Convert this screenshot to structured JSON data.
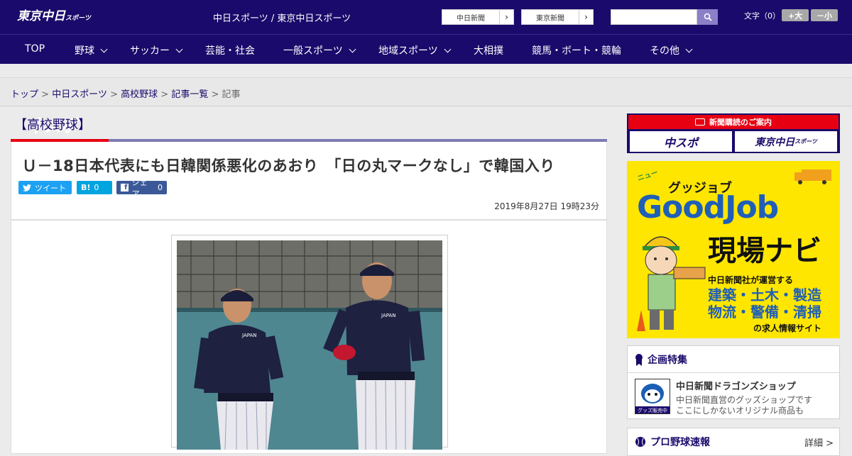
{
  "header": {
    "logo_main": "中スポ",
    "logo_sub": "東京中日",
    "logo_sub_small": "スポーツ",
    "site_name": "中日スポーツ / 東京中日スポーツ",
    "paper_chunichi": "中日新聞",
    "paper_tokyo": "東京新聞",
    "search_placeholder": "",
    "font_size_label": "文字（0）",
    "font_larger": "+大",
    "font_smaller": "－小"
  },
  "nav": {
    "items": [
      {
        "label": "TOP"
      },
      {
        "label": "野球"
      },
      {
        "label": "サッカー"
      },
      {
        "label": "芸能・社会"
      },
      {
        "label": "一般スポーツ"
      },
      {
        "label": "地域スポーツ"
      },
      {
        "label": "大相撲"
      },
      {
        "label": "競馬・ボート・競輪"
      },
      {
        "label": "その他"
      }
    ]
  },
  "breadcrumb": {
    "items": [
      "トップ",
      "中日スポーツ",
      "高校野球",
      "記事一覧"
    ],
    "current": "記事",
    "separator": ">"
  },
  "article": {
    "category": "【高校野球】",
    "headline": "Ｕ－18日本代表にも日韓関係悪化のあおり　「日の丸マークなし」で韓国入り",
    "tweet_label": "ツイート",
    "hatena_label": "B!",
    "hatena_count": "0",
    "facebook_label": "シェア",
    "facebook_count": "0",
    "date": "2019年8月27日 19時23分",
    "photo_jersey_text": "JAPAN"
  },
  "sidebar": {
    "subscription_title": "新聞購読のご案内",
    "paper1": "中スポ",
    "paper2": "東京中日",
    "paper2_small": "スポーツ",
    "ad": {
      "top_text": "グッジョブ",
      "brand": "GoodJob",
      "title": "現場ナビ",
      "operator": "中日新聞社が運営する",
      "line1": "建築・土木・製造",
      "line2": "物流・警備・清掃",
      "footer": "の求人情報サイト",
      "badge": "ニュー"
    },
    "feature": {
      "heading": "企画特集",
      "item_title": "中日新聞ドラゴンズショップ",
      "item_line1": "中日新聞直営のグッズショップです",
      "item_line2": "ここにしかないオリジナル商品も",
      "thumb_label": "グッズ販売中"
    },
    "baseball": {
      "heading": "プロ野球速報",
      "detail_link": "詳細 >"
    }
  },
  "colors": {
    "brand_navy": "#1a0a6b",
    "accent_red": "#e60012",
    "twitter": "#1da1f2",
    "hatena": "#00a4de",
    "facebook": "#3b5998",
    "ad_yellow": "#ffe600"
  }
}
